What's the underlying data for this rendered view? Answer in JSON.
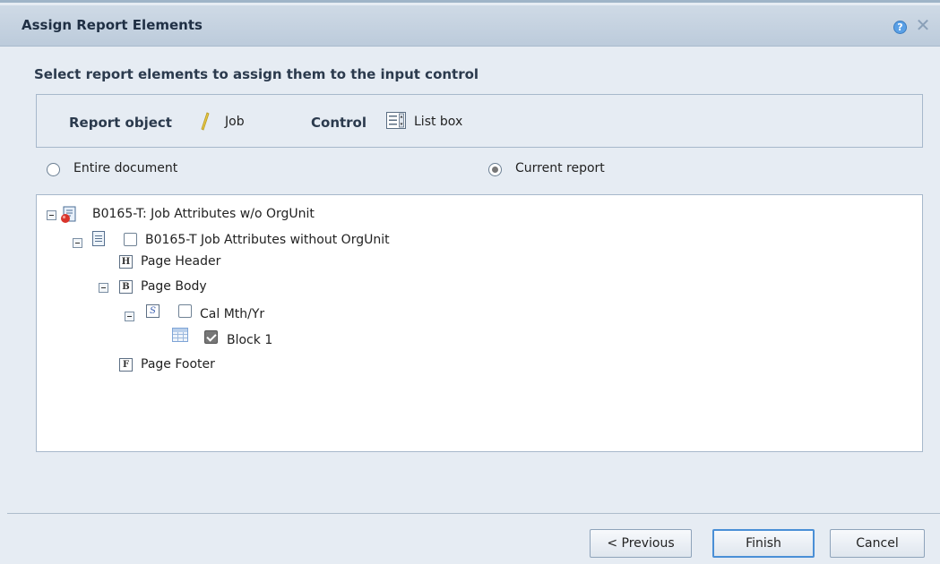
{
  "dialog": {
    "title": "Assign Report Elements",
    "help_icon": "help-icon",
    "close_icon": "close-icon"
  },
  "heading": "Select report elements to assign them to the input control",
  "info": {
    "report_object_label": "Report object",
    "report_object_value": "Job",
    "report_object_icon": "dimension-icon",
    "control_label": "Control",
    "control_value": "List box",
    "control_icon": "list-box-icon"
  },
  "scope": {
    "entire_document": {
      "label": "Entire document",
      "selected": false
    },
    "current_report": {
      "label": "Current report",
      "selected": true
    }
  },
  "tree": {
    "root": {
      "label": "B0165-T: Job Attributes w/o OrgUnit",
      "icon": "webi-document-icon",
      "expanded": true
    },
    "report": {
      "label": "B0165-T Job Attributes without OrgUnit",
      "icon": "report-icon",
      "checked": false,
      "expanded": true
    },
    "page_header": {
      "label": "Page Header",
      "icon_letter": "H"
    },
    "page_body": {
      "label": "Page Body",
      "icon_letter": "B",
      "expanded": true
    },
    "section": {
      "label": "Cal Mth/Yr",
      "icon_letter": "S",
      "checked": false,
      "expanded": true
    },
    "block": {
      "label": "Block 1",
      "icon": "table-icon",
      "checked": true
    },
    "page_footer": {
      "label": "Page Footer",
      "icon_letter": "F"
    }
  },
  "buttons": {
    "previous": "< Previous",
    "finish": "Finish",
    "cancel": "Cancel"
  }
}
